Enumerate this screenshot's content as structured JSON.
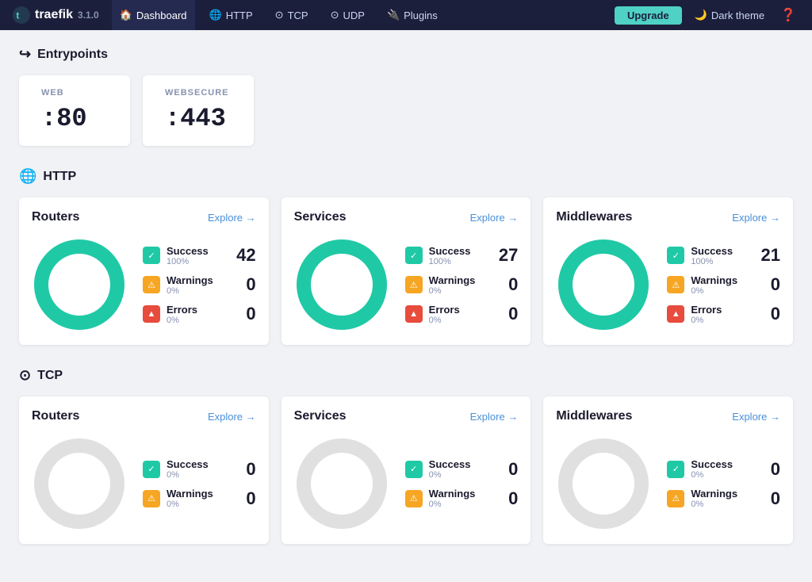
{
  "nav": {
    "logo": "traefik",
    "version": "3.1.0",
    "links": [
      {
        "label": "Dashboard",
        "icon": "🏠",
        "active": true
      },
      {
        "label": "HTTP",
        "icon": "🌐"
      },
      {
        "label": "TCP",
        "icon": "⊙"
      },
      {
        "label": "UDP",
        "icon": "⊙"
      },
      {
        "label": "Plugins",
        "icon": "🔌"
      }
    ],
    "upgrade_label": "Upgrade",
    "dark_theme_label": "Dark theme",
    "help_icon": "?"
  },
  "entrypoints": {
    "section_label": "Entrypoints",
    "items": [
      {
        "name": "WEB",
        "port": ":80"
      },
      {
        "name": "WEBSECURE",
        "port": ":443"
      }
    ]
  },
  "http": {
    "section_label": "HTTP",
    "cards": [
      {
        "title": "Routers",
        "explore_label": "Explore →",
        "total": 42,
        "stats": [
          {
            "label": "Success",
            "pct": "100%",
            "count": 42,
            "type": "success"
          },
          {
            "label": "Warnings",
            "pct": "0%",
            "count": 0,
            "type": "warning"
          },
          {
            "label": "Errors",
            "pct": "0%",
            "count": 0,
            "type": "error"
          }
        ]
      },
      {
        "title": "Services",
        "explore_label": "Explore →",
        "total": 27,
        "stats": [
          {
            "label": "Success",
            "pct": "100%",
            "count": 27,
            "type": "success"
          },
          {
            "label": "Warnings",
            "pct": "0%",
            "count": 0,
            "type": "warning"
          },
          {
            "label": "Errors",
            "pct": "0%",
            "count": 0,
            "type": "error"
          }
        ]
      },
      {
        "title": "Middlewares",
        "explore_label": "Explore →",
        "total": 21,
        "stats": [
          {
            "label": "Success",
            "pct": "100%",
            "count": 21,
            "type": "success"
          },
          {
            "label": "Warnings",
            "pct": "0%",
            "count": 0,
            "type": "warning"
          },
          {
            "label": "Errors",
            "pct": "0%",
            "count": 0,
            "type": "error"
          }
        ]
      }
    ]
  },
  "tcp": {
    "section_label": "TCP",
    "cards": [
      {
        "title": "Routers",
        "explore_label": "Explore →",
        "total": 0,
        "stats": [
          {
            "label": "Success",
            "pct": "0%",
            "count": 0,
            "type": "success"
          },
          {
            "label": "Warnings",
            "pct": "0%",
            "count": 0,
            "type": "warning"
          }
        ]
      },
      {
        "title": "Services",
        "explore_label": "Explore →",
        "total": 0,
        "stats": [
          {
            "label": "Success",
            "pct": "0%",
            "count": 0,
            "type": "success"
          },
          {
            "label": "Warnings",
            "pct": "0%",
            "count": 0,
            "type": "warning"
          }
        ]
      },
      {
        "title": "Middlewares",
        "explore_label": "Explore →",
        "total": 0,
        "stats": [
          {
            "label": "Success",
            "pct": "0%",
            "count": 0,
            "type": "success"
          },
          {
            "label": "Warnings",
            "pct": "0%",
            "count": 0,
            "type": "warning"
          }
        ]
      }
    ]
  }
}
